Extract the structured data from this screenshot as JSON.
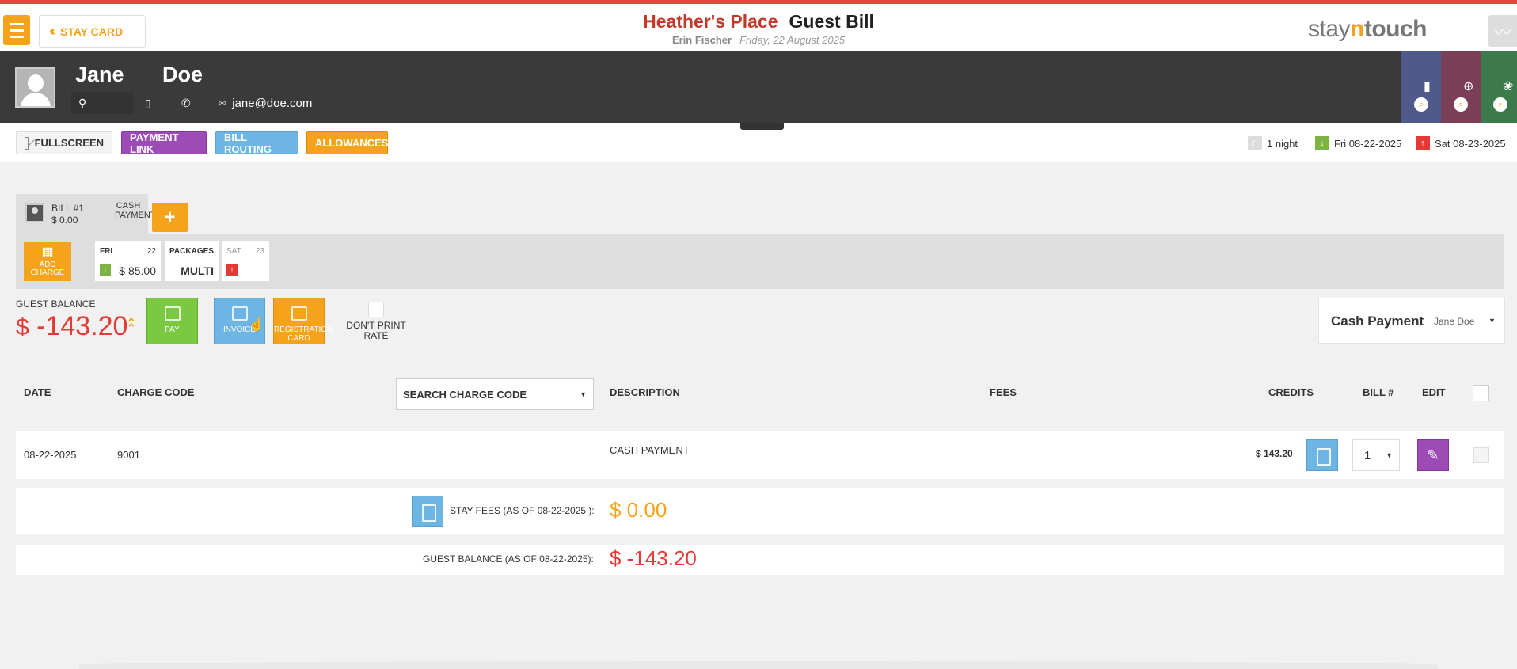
{
  "header": {
    "menu_icon": "hamburger-icon",
    "back_label": "STAY CARD",
    "hotel_name": "Heather's Place",
    "page_title": "Guest Bill",
    "user_name": "Erin Fischer",
    "business_date": "Friday, 22 August 2025",
    "logo": {
      "part1": "stay",
      "part2": "n",
      "part3": "touch"
    }
  },
  "guest": {
    "first_name": "Jane",
    "last_name": "Doe",
    "email": "jane@doe.com"
  },
  "actions": {
    "fullscreen": "FULLSCREEN",
    "payment_link": "PAYMENT LINK",
    "bill_routing": "BILL ROUTING",
    "allowances": "ALLOWANCES"
  },
  "stay": {
    "nights": "1 night",
    "arrival": "Fri 08-22-2025",
    "departure": "Sat 08-23-2025"
  },
  "bill_tab": {
    "bill_number": "BILL #1",
    "amount": "$ 0.00",
    "type": "CASH PAYMENT",
    "add_label": "+"
  },
  "day_strip": {
    "add_charge": "ADD CHARGE",
    "days": [
      {
        "day": "FRI",
        "num": "22",
        "amount": "$ 85.00"
      },
      {
        "day": "PACKAGES",
        "value": "MULTI"
      },
      {
        "day": "SAT",
        "num": "23"
      }
    ]
  },
  "balance": {
    "label": "GUEST BALANCE",
    "currency": "$",
    "amount": "-143.20",
    "pay": "PAY",
    "invoice": "INVOICE",
    "registration": "REGISTRATION CARD",
    "dont_print_rate": "DON'T PRINT RATE"
  },
  "payment_type": {
    "title": "Cash Payment",
    "name": "Jane Doe"
  },
  "table": {
    "headers": {
      "date": "DATE",
      "charge_code": "CHARGE CODE",
      "search": "SEARCH CHARGE CODE",
      "description": "DESCRIPTION",
      "fees": "FEES",
      "credits": "CREDITS",
      "bill": "BILL #",
      "edit": "EDIT"
    },
    "rows": [
      {
        "date": "08-22-2025",
        "code": "9001",
        "description": "CASH PAYMENT",
        "credits": "$ 143.20",
        "bill": "1"
      }
    ]
  },
  "summary": {
    "stay_fees_label": "STAY FEES (AS OF  08-22-2025 ):",
    "stay_fees_value": "$ 0.00",
    "guest_balance_label": "GUEST BALANCE (AS OF  08-22-2025):",
    "guest_balance_value": "$ -143.20"
  },
  "colors": {
    "accent": "#f5a31a",
    "brand_red": "#e2493b",
    "negative": "#e53935",
    "purple": "#9c4cb4",
    "blue": "#6db6e3",
    "green": "#7bc940"
  }
}
